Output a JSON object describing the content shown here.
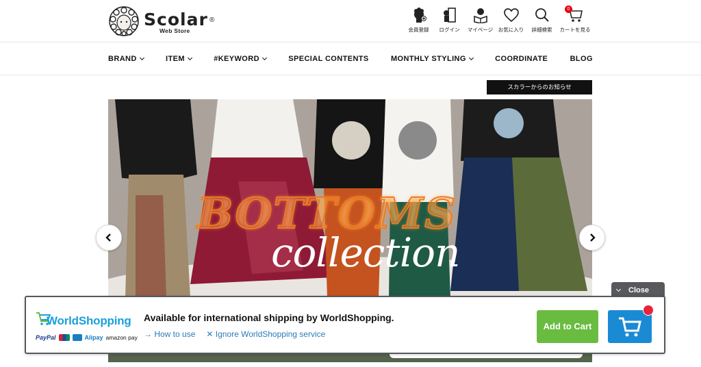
{
  "header": {
    "logo": {
      "word": "Scolar",
      "registered": "®",
      "sub": "Web Store"
    },
    "icons": [
      {
        "label": "会員登録",
        "icon": "member-register-icon"
      },
      {
        "label": "ログイン",
        "icon": "login-icon"
      },
      {
        "label": "マイページ",
        "icon": "mypage-icon"
      },
      {
        "label": "お気に入り",
        "icon": "heart-icon"
      },
      {
        "label": "詳細検索",
        "icon": "search-icon"
      },
      {
        "label": "カートを見る",
        "icon": "cart-icon",
        "count": "0"
      }
    ]
  },
  "nav": {
    "items": [
      {
        "label": "BRAND",
        "dropdown": true
      },
      {
        "label": "ITEM",
        "dropdown": true
      },
      {
        "label": "#KEYWORD",
        "dropdown": true
      },
      {
        "label": "SPECIAL CONTENTS",
        "dropdown": false
      },
      {
        "label": "MONTHLY STYLING",
        "dropdown": true
      },
      {
        "label": "COORDINATE",
        "dropdown": false
      },
      {
        "label": "BLOG",
        "dropdown": false
      }
    ]
  },
  "notice": {
    "label": "スカラーからのお知らせ"
  },
  "hero": {
    "title": "BOTTOMS",
    "subtitle": "collection"
  },
  "worldshopping": {
    "close_label": "Close",
    "logo_text": "WorldShopping",
    "payments": [
      "PayPal",
      "Alipay",
      "amazon pay"
    ],
    "title": "Available for international shipping by WorldShopping.",
    "link_howto": "How to use",
    "link_ignore": "Ignore WorldShopping service",
    "add_to_cart": "Add to Cart"
  },
  "colors": {
    "accent_green": "#6abc41",
    "accent_blue": "#1b8ad4",
    "badge_red": "#e60012",
    "hero_title_orange": "#f07a1e"
  }
}
